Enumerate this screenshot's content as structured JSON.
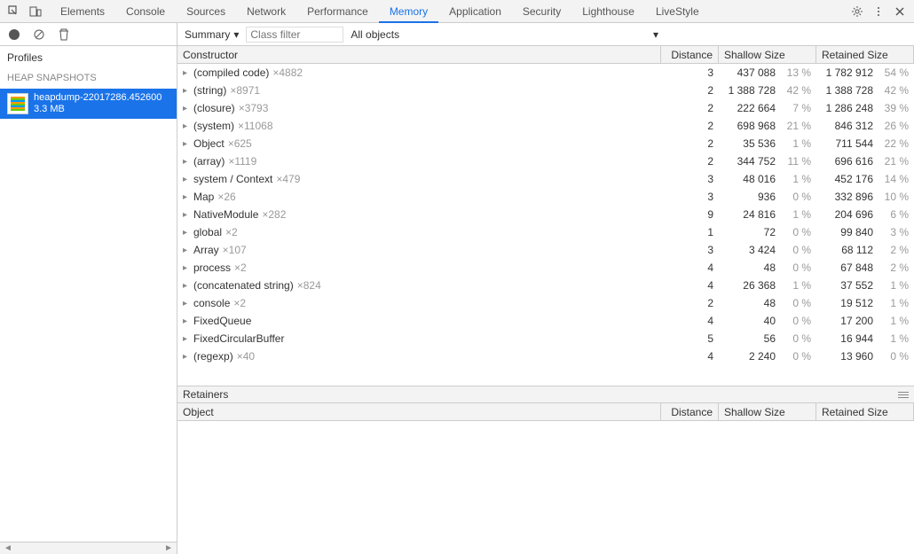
{
  "tabs": [
    "Elements",
    "Console",
    "Sources",
    "Network",
    "Performance",
    "Memory",
    "Application",
    "Security",
    "Lighthouse",
    "LiveStyle"
  ],
  "active_tab": "Memory",
  "sidebar": {
    "profiles_label": "Profiles",
    "section_label": "HEAP SNAPSHOTS",
    "snapshot": {
      "name": "heapdump-22017286.452600",
      "size": "3.3 MB"
    }
  },
  "filters": {
    "mode": "Summary",
    "class_filter_placeholder": "Class filter",
    "objects_scope": "All objects"
  },
  "headers": {
    "constructor": "Constructor",
    "distance": "Distance",
    "shallow": "Shallow Size",
    "retained": "Retained Size"
  },
  "rows": [
    {
      "name": "(compiled code)",
      "count": "×4882",
      "distance": "3",
      "shallow": "437 088",
      "shallow_pct": "13 %",
      "retained": "1 782 912",
      "retained_pct": "54 %"
    },
    {
      "name": "(string)",
      "count": "×8971",
      "distance": "2",
      "shallow": "1 388 728",
      "shallow_pct": "42 %",
      "retained": "1 388 728",
      "retained_pct": "42 %"
    },
    {
      "name": "(closure)",
      "count": "×3793",
      "distance": "2",
      "shallow": "222 664",
      "shallow_pct": "7 %",
      "retained": "1 286 248",
      "retained_pct": "39 %"
    },
    {
      "name": "(system)",
      "count": "×11068",
      "distance": "2",
      "shallow": "698 968",
      "shallow_pct": "21 %",
      "retained": "846 312",
      "retained_pct": "26 %"
    },
    {
      "name": "Object",
      "count": "×625",
      "distance": "2",
      "shallow": "35 536",
      "shallow_pct": "1 %",
      "retained": "711 544",
      "retained_pct": "22 %"
    },
    {
      "name": "(array)",
      "count": "×1119",
      "distance": "2",
      "shallow": "344 752",
      "shallow_pct": "11 %",
      "retained": "696 616",
      "retained_pct": "21 %"
    },
    {
      "name": "system / Context",
      "count": "×479",
      "distance": "3",
      "shallow": "48 016",
      "shallow_pct": "1 %",
      "retained": "452 176",
      "retained_pct": "14 %"
    },
    {
      "name": "Map",
      "count": "×26",
      "distance": "3",
      "shallow": "936",
      "shallow_pct": "0 %",
      "retained": "332 896",
      "retained_pct": "10 %"
    },
    {
      "name": "NativeModule",
      "count": "×282",
      "distance": "9",
      "shallow": "24 816",
      "shallow_pct": "1 %",
      "retained": "204 696",
      "retained_pct": "6 %"
    },
    {
      "name": "global",
      "count": "×2",
      "distance": "1",
      "shallow": "72",
      "shallow_pct": "0 %",
      "retained": "99 840",
      "retained_pct": "3 %"
    },
    {
      "name": "Array",
      "count": "×107",
      "distance": "3",
      "shallow": "3 424",
      "shallow_pct": "0 %",
      "retained": "68 112",
      "retained_pct": "2 %"
    },
    {
      "name": "process",
      "count": "×2",
      "distance": "4",
      "shallow": "48",
      "shallow_pct": "0 %",
      "retained": "67 848",
      "retained_pct": "2 %"
    },
    {
      "name": "(concatenated string)",
      "count": "×824",
      "distance": "4",
      "shallow": "26 368",
      "shallow_pct": "1 %",
      "retained": "37 552",
      "retained_pct": "1 %"
    },
    {
      "name": "console",
      "count": "×2",
      "distance": "2",
      "shallow": "48",
      "shallow_pct": "0 %",
      "retained": "19 512",
      "retained_pct": "1 %"
    },
    {
      "name": "FixedQueue",
      "count": "",
      "distance": "4",
      "shallow": "40",
      "shallow_pct": "0 %",
      "retained": "17 200",
      "retained_pct": "1 %"
    },
    {
      "name": "FixedCircularBuffer",
      "count": "",
      "distance": "5",
      "shallow": "56",
      "shallow_pct": "0 %",
      "retained": "16 944",
      "retained_pct": "1 %"
    },
    {
      "name": "(regexp)",
      "count": "×40",
      "distance": "4",
      "shallow": "2 240",
      "shallow_pct": "0 %",
      "retained": "13 960",
      "retained_pct": "0 %"
    }
  ],
  "retainers": {
    "title": "Retainers",
    "headers": {
      "object": "Object",
      "distance": "Distance",
      "shallow": "Shallow Size",
      "retained": "Retained Size"
    }
  }
}
